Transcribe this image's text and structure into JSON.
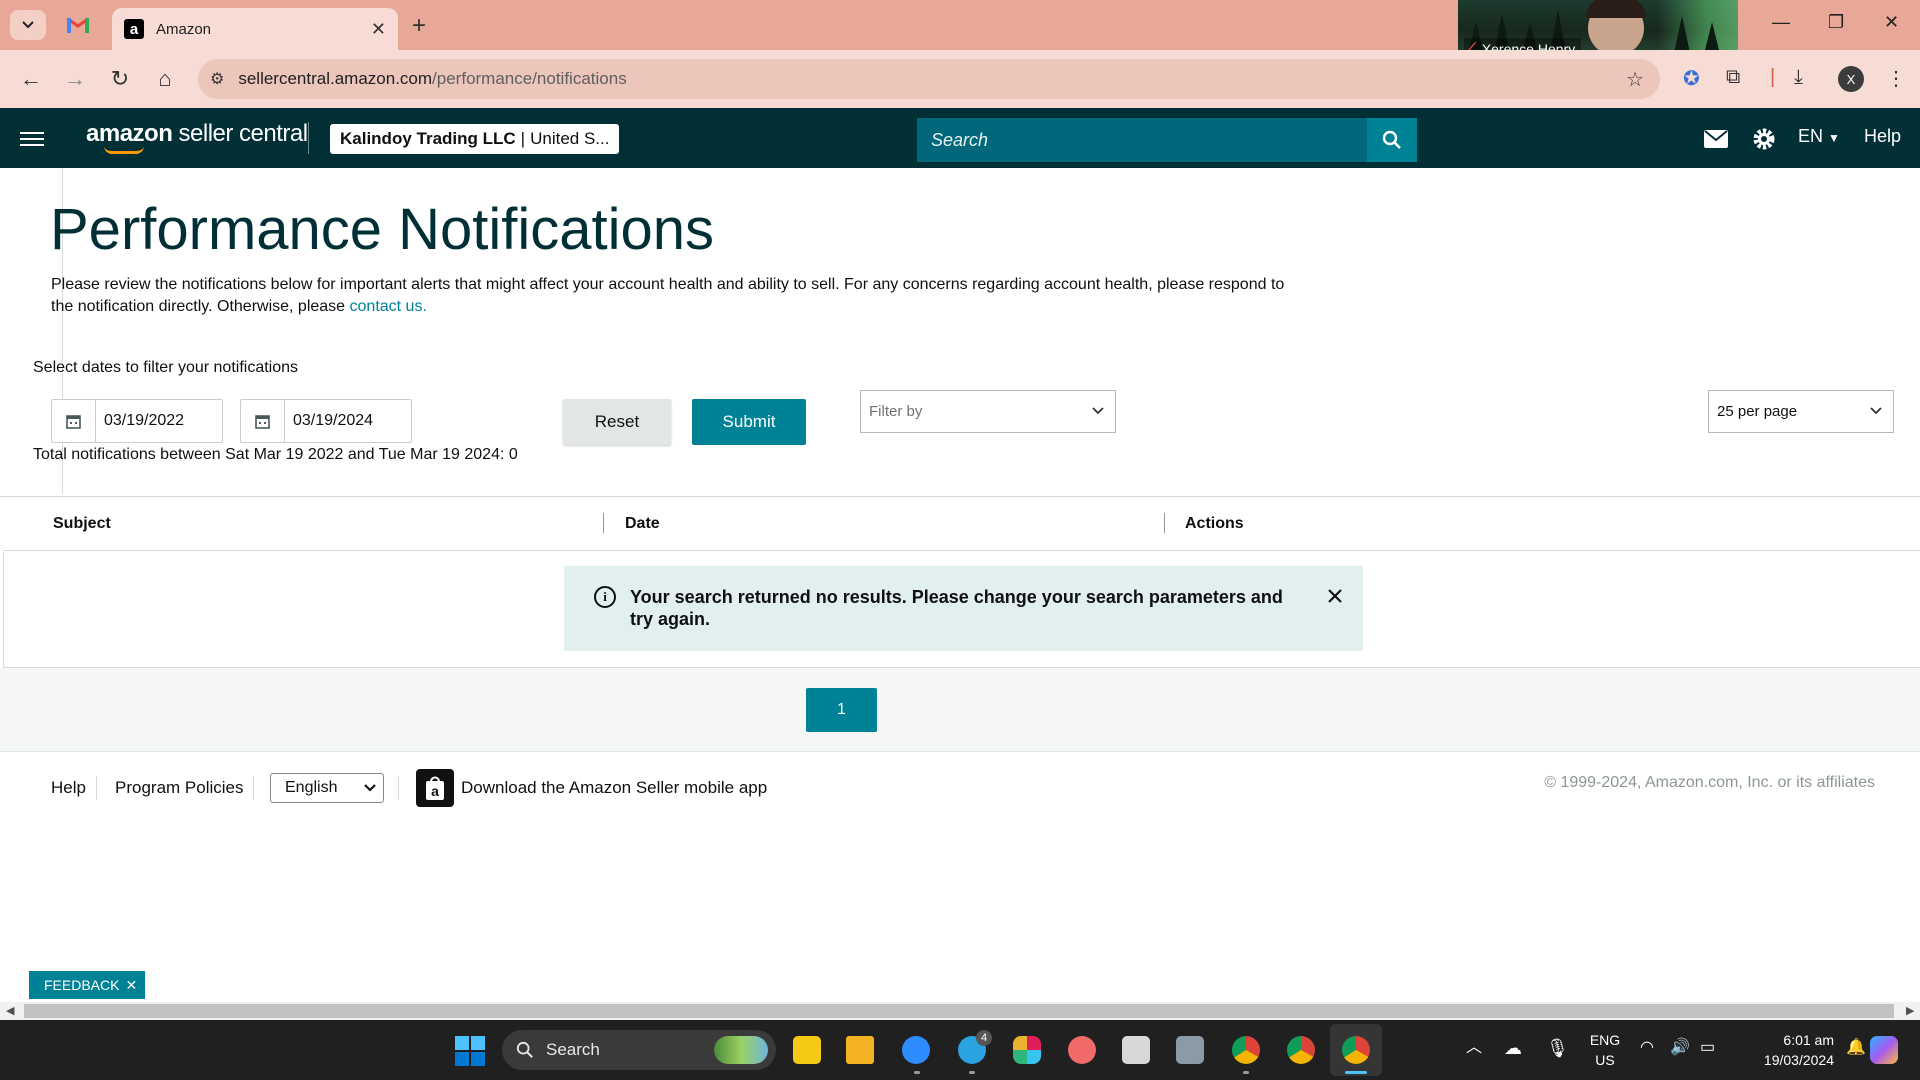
{
  "browser": {
    "tab_title": "Amazon",
    "url_host": "sellercentral.amazon.com",
    "url_path": "/performance/notifications",
    "video_participant": "Xerence Henry",
    "profile_initial": "X"
  },
  "header": {
    "logo_bold": "amazon",
    "logo_rest": " seller central",
    "account_name": "Kalindoy Trading LLC",
    "account_separator": "|",
    "account_region": "United S...",
    "search_placeholder": "Search",
    "language": "EN",
    "help": "Help",
    "icons": [
      "menu-icon",
      "search-icon",
      "mail-icon",
      "gear-icon",
      "caret-down-icon"
    ]
  },
  "main": {
    "title": "Performance Notifications",
    "intro_text": "Please review the notifications below for important alerts that might affect your account health and ability to sell. For any concerns regarding account health, please respond to the notification directly. Otherwise, please ",
    "intro_link": "contact us.",
    "filter_label": "Select dates to filter your notifications",
    "start_date": "03/19/2022",
    "end_date": "03/19/2024",
    "reset_label": "Reset",
    "submit_label": "Submit",
    "filter_by": "Filter by",
    "per_page": "25 per page",
    "total_text": "Total notifications between Sat Mar 19 2022 and Tue Mar 19 2024: 0"
  },
  "table": {
    "columns": [
      "Subject",
      "Date",
      "Actions"
    ],
    "empty_message": "Your search returned no results. Please change your search parameters and try again."
  },
  "pagination": {
    "current_page": "1"
  },
  "footer": {
    "help": "Help",
    "program_policies": "Program Policies",
    "language": "English",
    "app_download": "Download the Amazon Seller mobile app",
    "copyright": "© 1999-2024, Amazon.com, Inc. or its affiliates",
    "feedback": "FEEDBACK"
  },
  "taskbar": {
    "search_label": "Search",
    "lang_line1": "ENG",
    "lang_line2": "US",
    "time": "6:01 am",
    "date": "19/03/2024",
    "telegram_badge": "4"
  },
  "colors": {
    "header_bg": "#002f36",
    "accent": "#008296",
    "alert_bg": "#e2efef",
    "browser_chrome": "#e8a898"
  }
}
